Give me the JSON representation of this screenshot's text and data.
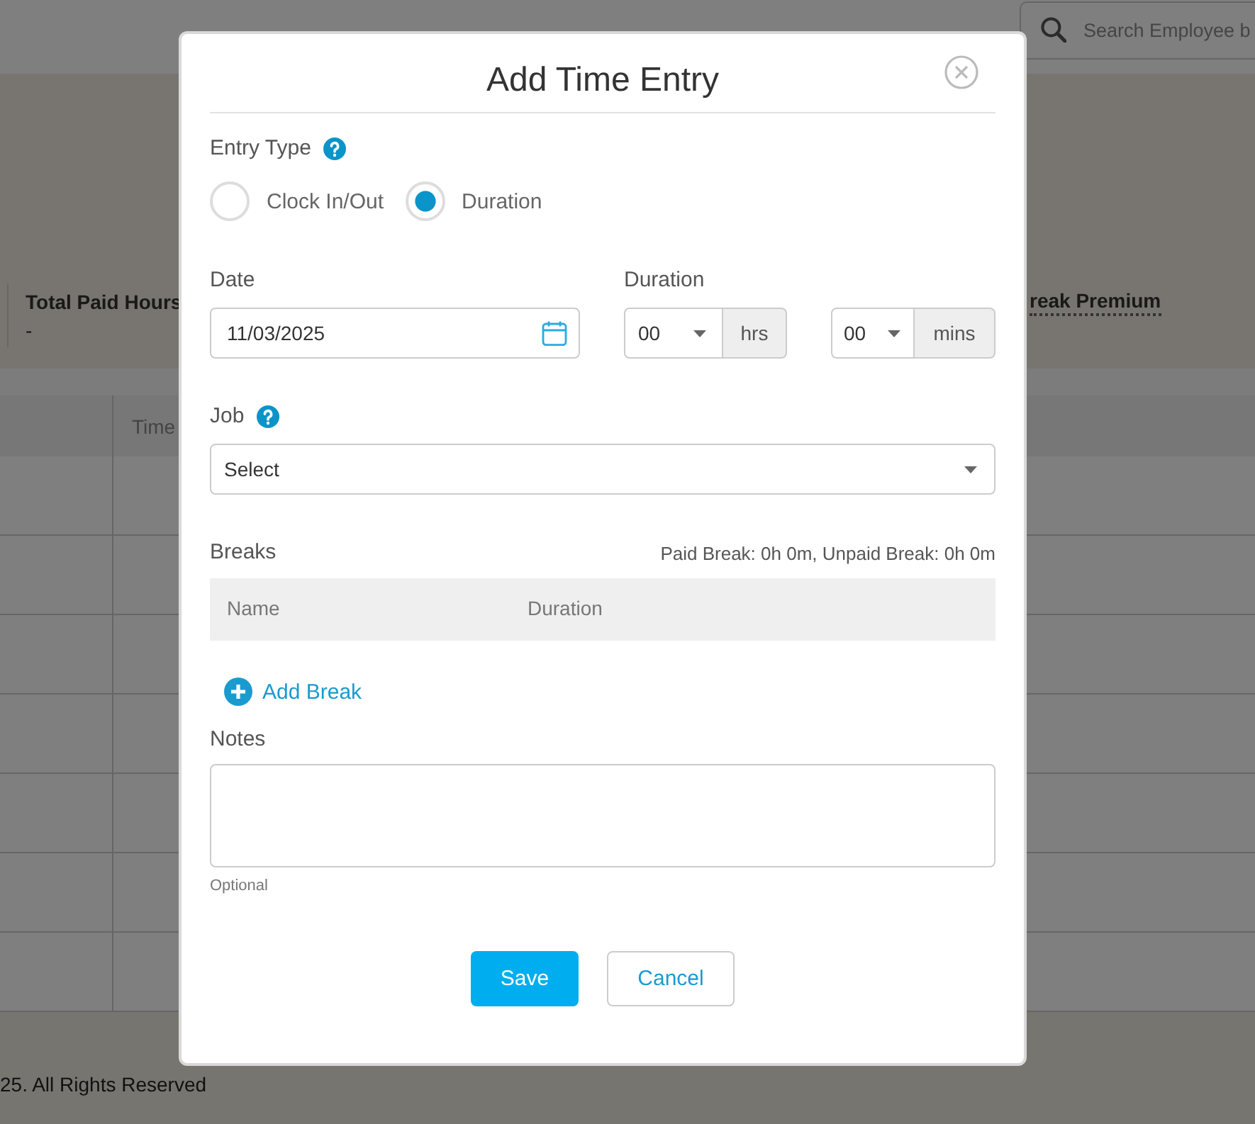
{
  "background": {
    "search": {
      "placeholder": "Search Employee b"
    },
    "summary": [
      {
        "kind": "plain",
        "label": "Total Paid Hours",
        "value": "-"
      },
      {
        "kind": "underlined",
        "label": "reak Premium"
      }
    ],
    "table": {
      "columns": [
        {
          "label": "Time"
        }
      ]
    },
    "footer": "25. All Rights Reserved"
  },
  "dialog": {
    "title": "Add Time Entry",
    "entry_type": {
      "label": "Entry Type",
      "options": [
        {
          "label": "Clock In/Out",
          "selected": false
        },
        {
          "label": "Duration",
          "selected": true
        }
      ]
    },
    "date": {
      "label": "Date",
      "value": "11/03/2025"
    },
    "duration": {
      "label": "Duration",
      "parts": [
        {
          "value": "00",
          "unit": "hrs"
        },
        {
          "value": "00",
          "unit": "mins"
        }
      ]
    },
    "job": {
      "label": "Job",
      "value": "Select"
    },
    "breaks": {
      "label": "Breaks",
      "summary": "Paid Break: 0h 0m, Unpaid Break: 0h 0m",
      "columns": [
        "Name",
        "Duration"
      ],
      "add_label": "Add Break"
    },
    "notes": {
      "label": "Notes",
      "hint": "Optional"
    },
    "buttons": [
      {
        "label": "Save",
        "kind": "primary"
      },
      {
        "label": "Cancel",
        "kind": "secondary"
      }
    ]
  }
}
